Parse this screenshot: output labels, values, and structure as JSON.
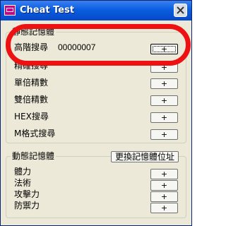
{
  "window": {
    "title": "Cheat Test",
    "icon": "app-icon",
    "close_icon": "close-icon"
  },
  "static_memory": {
    "group_label": "靜態記憶體",
    "rows": [
      {
        "label": "高階搜尋",
        "value": "00000007",
        "button": "+"
      },
      {
        "label": "精確搜尋",
        "button": "+"
      },
      {
        "label": "單倍精數",
        "button": "+"
      },
      {
        "label": "雙倍精數",
        "button": "+"
      },
      {
        "label": "HEX搜尋",
        "button": "+"
      },
      {
        "label": "M格式搜尋",
        "button": "+"
      }
    ]
  },
  "dynamic_memory": {
    "group_label": "動態記憶體",
    "change_address_button": "更換記憶體位址",
    "rows": [
      {
        "label": "體力",
        "button": "+"
      },
      {
        "label": "法術",
        "button": "+"
      },
      {
        "label": "攻擊力",
        "button": "+"
      },
      {
        "label": "防禦力",
        "button": "+"
      }
    ]
  },
  "colors": {
    "titlebar": "#0a5ee0",
    "window_bg": "#ece9d8",
    "highlight_oval": "#ee1111"
  }
}
